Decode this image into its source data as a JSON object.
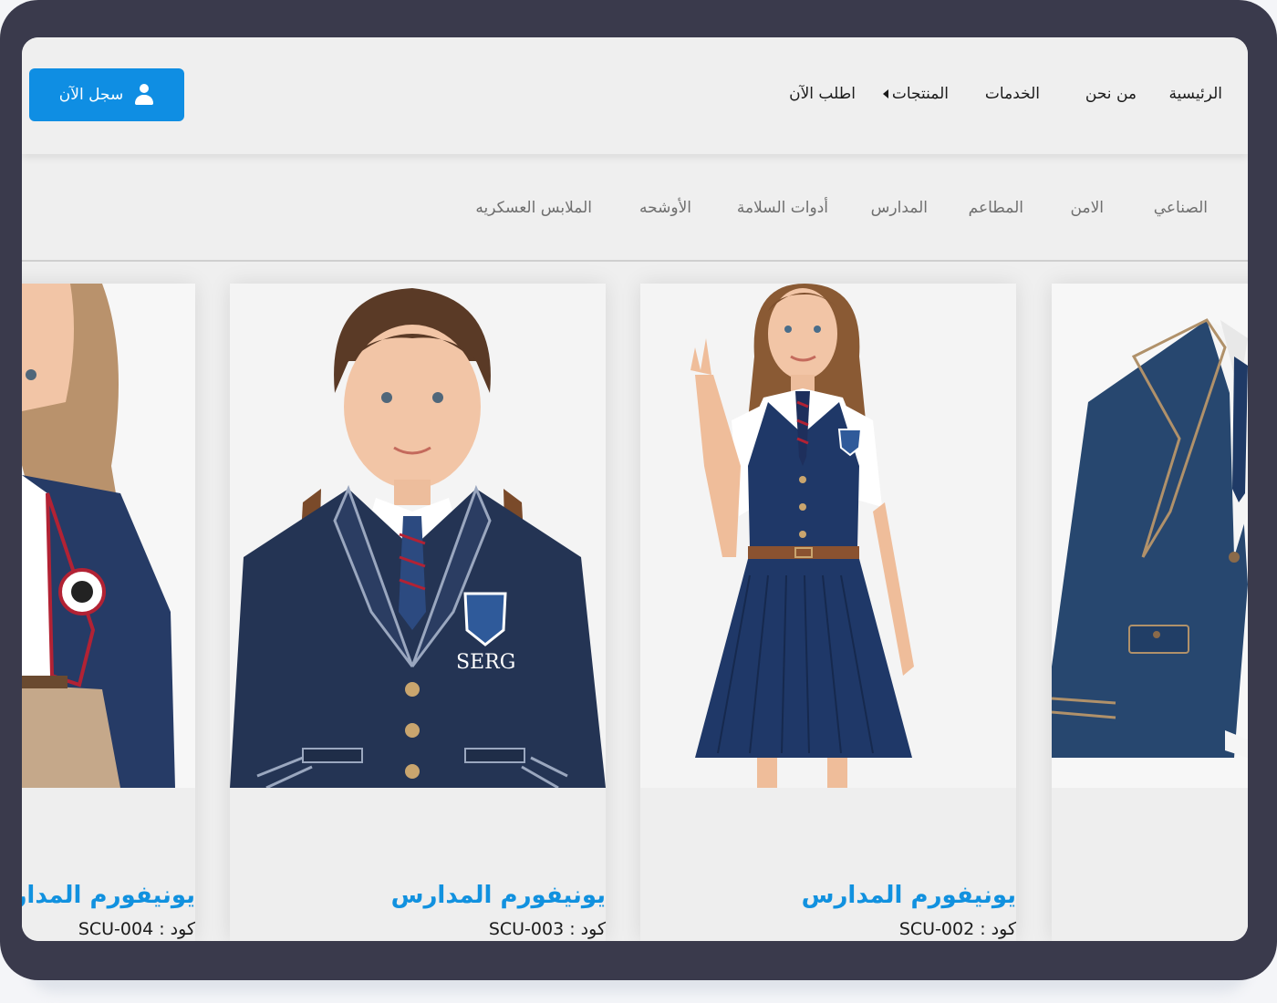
{
  "nav": {
    "items": [
      "الرئيسية",
      "من نحن",
      "الخدمات",
      "المنتجات",
      "اطلب الآن"
    ],
    "cta_label": "سجل الآن"
  },
  "categories": [
    "الصناعي",
    "الامن",
    "المطاعم",
    "المدارس",
    "أدوات السلامة",
    "الأوشحه",
    "الملابس العسكريه"
  ],
  "products": [
    {
      "title": "يونيفورم المدارس",
      "code_label": "كود :",
      "code": "SCU-002"
    },
    {
      "title": "يونيفورم المدارس",
      "code_label": "كود :",
      "code": "SCU-003"
    },
    {
      "title": "يونيفورم المدارس",
      "code_label": "كود :",
      "code": "SCU-004"
    }
  ],
  "illustrations": {
    "badge_text": "SERG"
  }
}
